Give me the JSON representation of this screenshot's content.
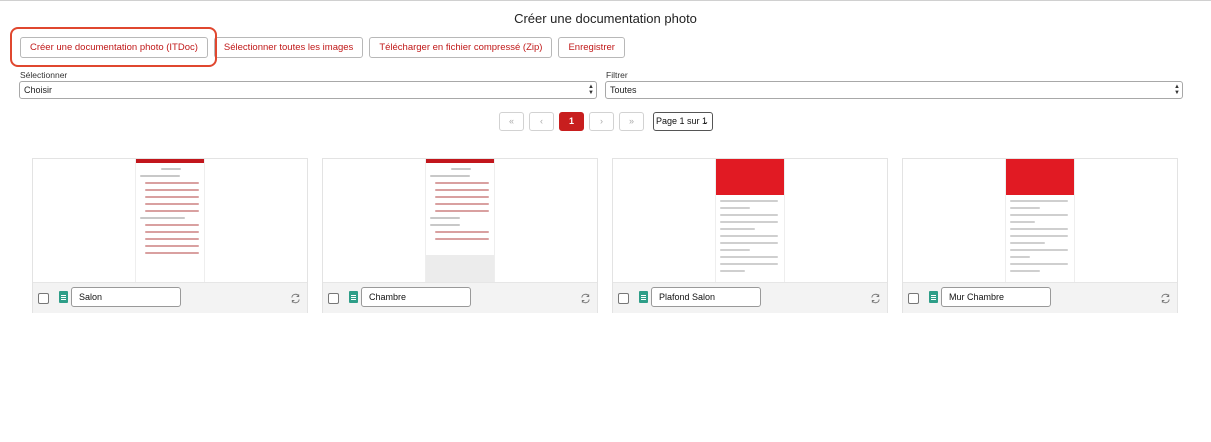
{
  "page": {
    "title": "Créer une documentation photo"
  },
  "toolbar": {
    "create_itdoc": "Créer une documentation photo (ITDoc)",
    "select_all": "Sélectionner toutes les images",
    "download_zip": "Télécharger en fichier compressé (Zip)",
    "save": "Enregistrer"
  },
  "select_field": {
    "label": "Sélectionner",
    "value": "Choisir"
  },
  "filter_field": {
    "label": "Filtrer",
    "value": "Toutes"
  },
  "pagination": {
    "first": "«",
    "prev": "‹",
    "current": "1",
    "next": "›",
    "last": "»",
    "page_select": "Page 1 sur 1"
  },
  "images": [
    {
      "name": "Salon"
    },
    {
      "name": "Chambre"
    },
    {
      "name": "Plafond Salon"
    },
    {
      "name": "Mur Chambre"
    }
  ],
  "colors": {
    "accent": "#c81e1e",
    "highlight": "#e0472f",
    "file_icon": "#2e9e88"
  }
}
